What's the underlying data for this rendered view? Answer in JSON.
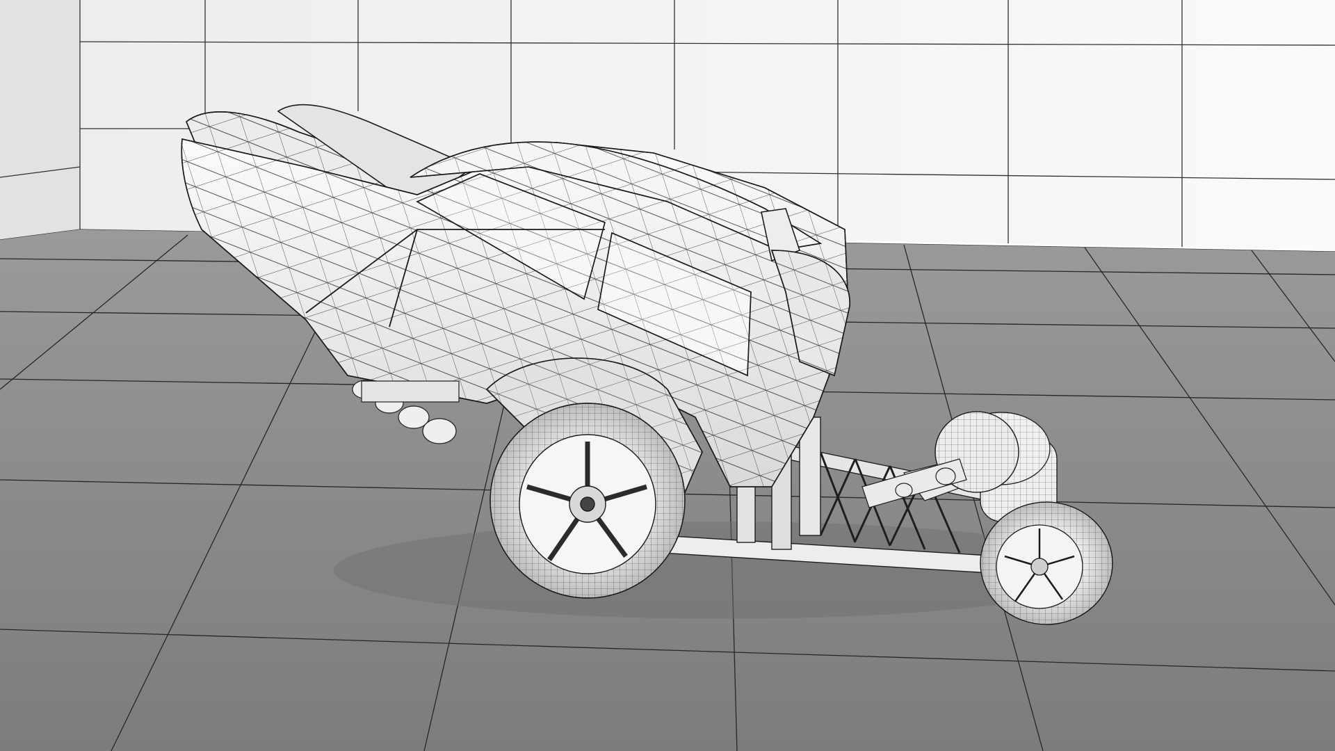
{
  "scene": {
    "subject": "wireframe-dragster-car",
    "render_style": "clay-with-wireframe-overlay",
    "colors": {
      "wall": "#f4f4f4",
      "floor": "#8c8c8c",
      "floor_near": "#7a7a7a",
      "grid_line": "#2a2a2a",
      "model_fill": "#f2f2f2",
      "model_shadow": "#cfcfcf",
      "wire": "#1a1a1a"
    }
  }
}
